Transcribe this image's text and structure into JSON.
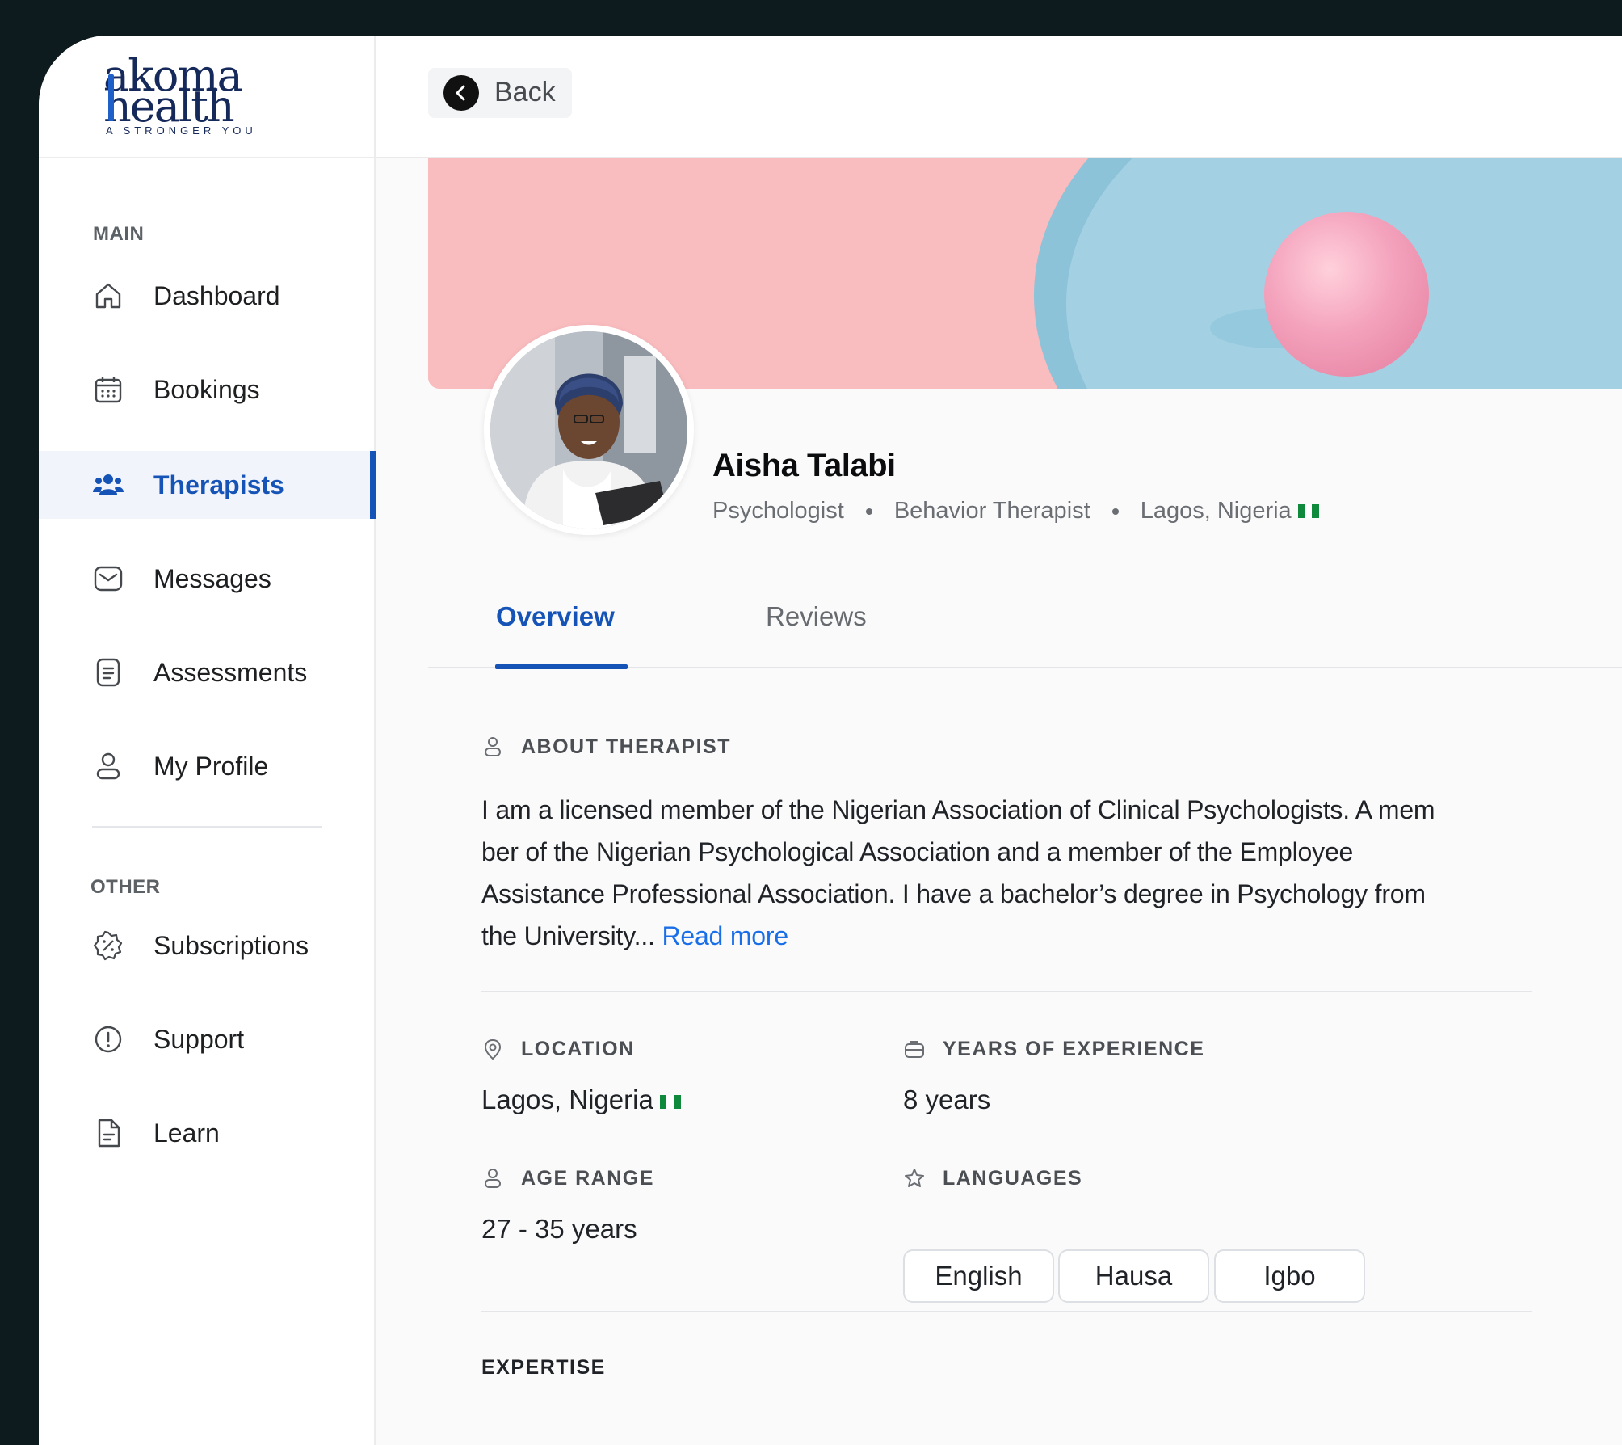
{
  "app": {
    "logo_line1": "akoma",
    "logo_line2": "health",
    "logo_tagline": "A STRONGER YOU"
  },
  "sidebar": {
    "main_heading": "MAIN",
    "other_heading": "OTHER",
    "main_items": [
      {
        "label": "Dashboard",
        "icon": "home-icon"
      },
      {
        "label": "Bookings",
        "icon": "calendar-icon"
      },
      {
        "label": "Therapists",
        "icon": "users-icon",
        "active": true
      },
      {
        "label": "Messages",
        "icon": "mail-icon"
      },
      {
        "label": "Assessments",
        "icon": "document-icon"
      },
      {
        "label": "My Profile",
        "icon": "user-icon"
      }
    ],
    "other_items": [
      {
        "label": "Subscriptions",
        "icon": "discount-badge-icon"
      },
      {
        "label": "Support",
        "icon": "alert-circle-icon"
      },
      {
        "label": "Learn",
        "icon": "file-icon"
      }
    ]
  },
  "topbar": {
    "back_label": "Back"
  },
  "profile": {
    "name": "Aisha Talabi",
    "roles": [
      "Psychologist",
      "Behavior Therapist"
    ],
    "location": "Lagos, Nigeria"
  },
  "tabs": {
    "overview": "Overview",
    "reviews": "Reviews",
    "active": "Overview"
  },
  "about": {
    "heading": "ABOUT THERAPIST",
    "line1": "I am a licensed member of the Nigerian Association of Clinical Psychologists. A mem",
    "line2": "ber of the Nigerian Psychological Association and a member of the Employee",
    "line3": "Assistance Professional Association. I have a bachelor’s degree in Psychology from",
    "line4": "the University...",
    "read_more": "Read more"
  },
  "details": {
    "location_heading": "LOCATION",
    "location_value": "Lagos, Nigeria",
    "experience_heading": "YEARS OF EXPERIENCE",
    "experience_value": "8 years",
    "age_heading": "AGE RANGE",
    "age_value": "27 - 35 years",
    "languages_heading": "LANGUAGES",
    "languages": [
      "English",
      "Hausa",
      "Igbo"
    ]
  },
  "expertise": {
    "heading": "EXPERTISE"
  },
  "colors": {
    "accent": "#1553b6",
    "link": "#1a6fe8",
    "flag_green": "#0f8a3c",
    "banner_pink": "#f9bcbf",
    "banner_blue": "#9fcde0"
  }
}
